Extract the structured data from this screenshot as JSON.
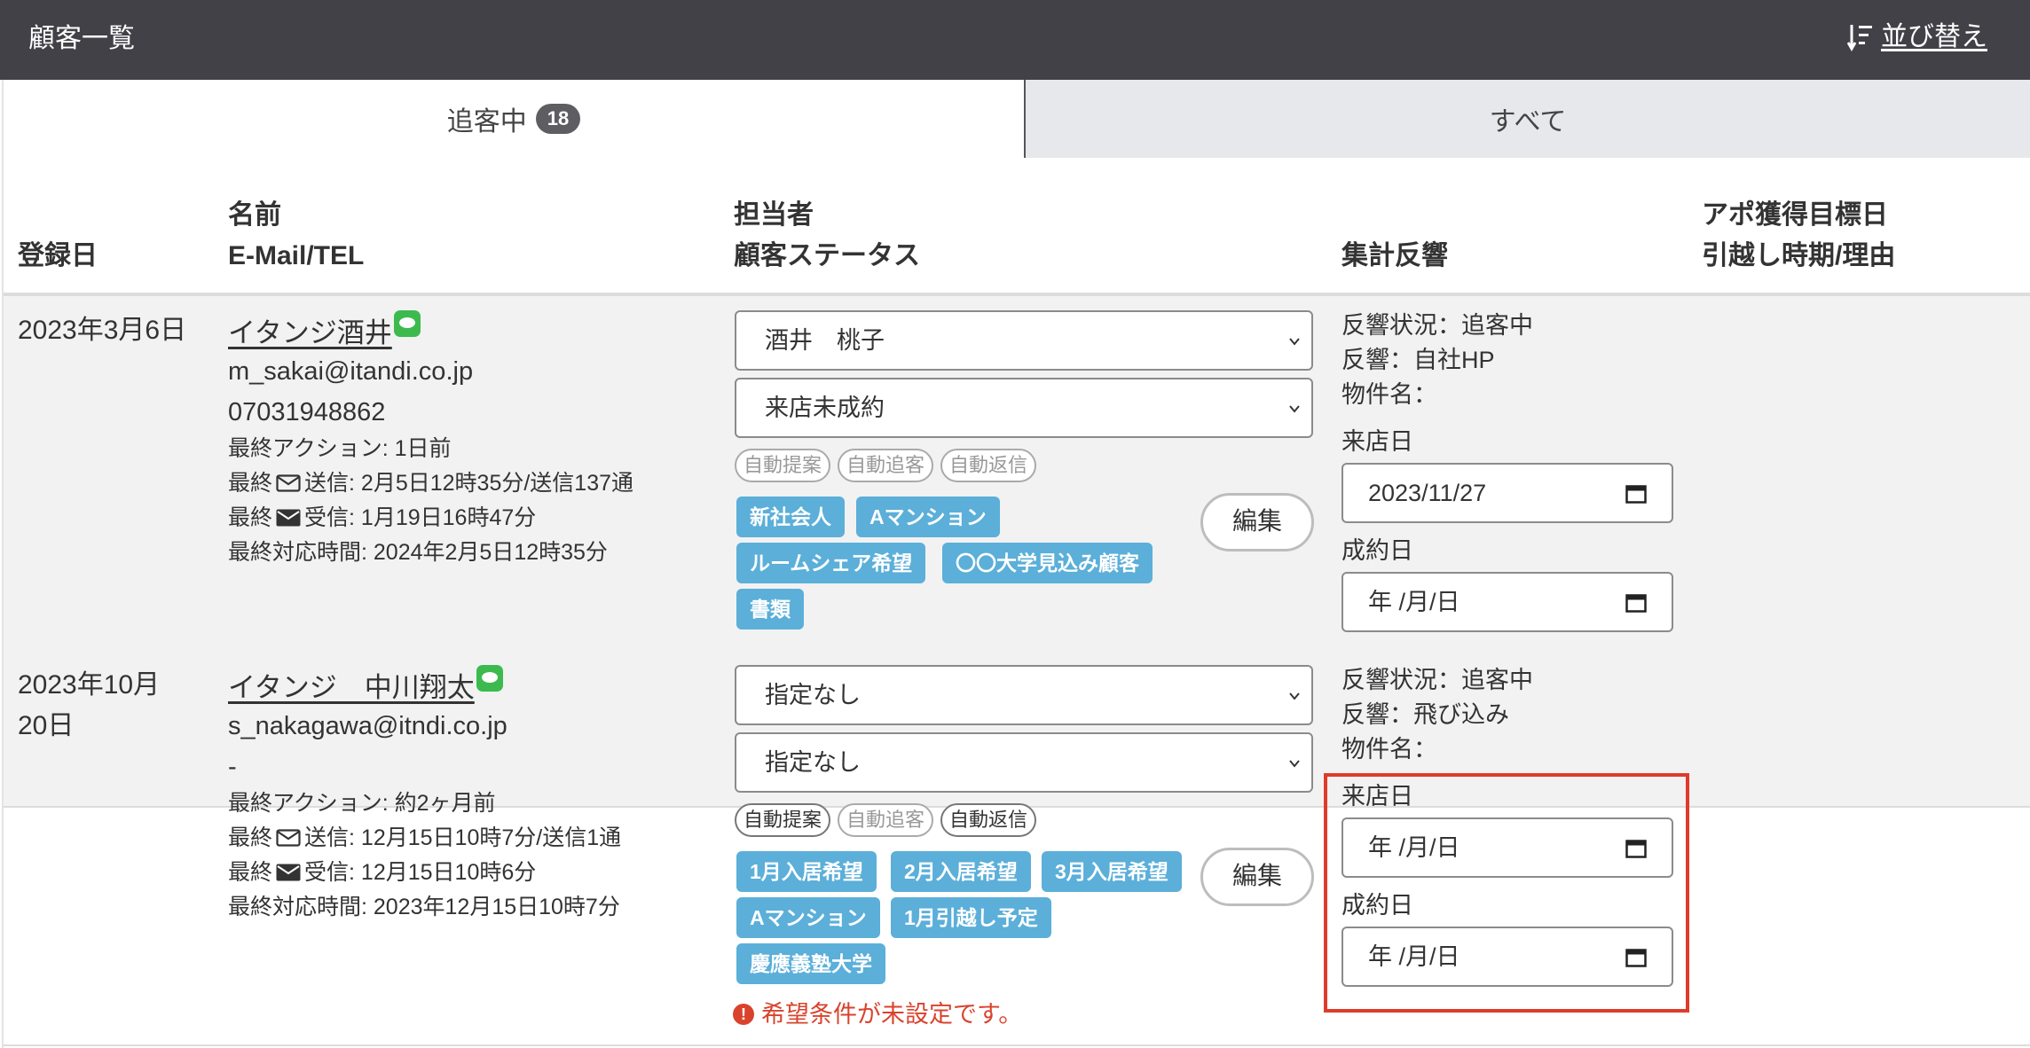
{
  "header": {
    "title": "顧客一覧",
    "sort_label": "並び替え"
  },
  "tabs": [
    {
      "label": "追客中",
      "badge": "18"
    },
    {
      "label": "すべて"
    }
  ],
  "columns": {
    "registered": "登録日",
    "name": "名前",
    "email_tel": "E-Mail/TEL",
    "assignee": "担当者",
    "customer_status": "顧客ステータス",
    "response": "集計反響",
    "appo_target": "アポ獲得目標日",
    "move_reason": "引越し時期/理由"
  },
  "labels": {
    "visit_date": "来店日",
    "contract_date": "成約日",
    "edit": "編集",
    "last_label": "最終",
    "sent_label": "送信:",
    "received_label": "受信:"
  },
  "auto_pills": [
    "自動提案",
    "自動追客",
    "自動返信"
  ],
  "rows": [
    {
      "date": "2023年3月6日",
      "name": "イタンジ酒井",
      "email": "m_sakai@itandi.co.jp",
      "tel": "07031948862",
      "last_action": "最終アクション: 1日前",
      "sent": "2月5日12時35分/送信137通",
      "received": "1月19日16時47分",
      "last_response_time": "最終対応時間: 2024年2月5日12時35分",
      "assignee": "酒井　桃子",
      "status": "来店未成約",
      "auto_active": [
        false,
        false,
        false
      ],
      "tags": [
        "新社会人",
        "Aマンション",
        "ルームシェア希望",
        "〇〇大学見込み顧客",
        "書類"
      ],
      "response_status": "反響状況：追客中",
      "response_source": "反響：自社HP",
      "property": "物件名：",
      "visit_date": "2023/11/27",
      "contract_date": "年 /月/日"
    },
    {
      "date": "2023年10月20日",
      "date_line1": "2023年10月",
      "date_line2": "20日",
      "name": "イタンジ　中川翔太",
      "email": "s_nakagawa@itndi.co.jp",
      "tel": "-",
      "last_action": "最終アクション: 約2ヶ月前",
      "sent": "12月15日10時7分/送信1通",
      "received": "12月15日10時6分",
      "last_response_time": "最終対応時間: 2023年12月15日10時7分",
      "assignee": "指定なし",
      "status": "指定なし",
      "auto_active": [
        true,
        false,
        true
      ],
      "tags": [
        "1月入居希望",
        "2月入居希望",
        "3月入居希望",
        "Aマンション",
        "1月引越し予定",
        "慶應義塾大学"
      ],
      "response_status": "反響状況：追客中",
      "response_source": "反響：飛び込み",
      "property": "物件名：",
      "visit_date": "年 /月/日",
      "contract_date": "年 /月/日",
      "warning": "希望条件が未設定です。"
    }
  ],
  "colors": {
    "header_bg": "#424147",
    "tag_bg": "#5bafd9",
    "line_green": "#3dba4e",
    "warning_red": "#d9432d",
    "highlight_border": "#df3b2a"
  }
}
